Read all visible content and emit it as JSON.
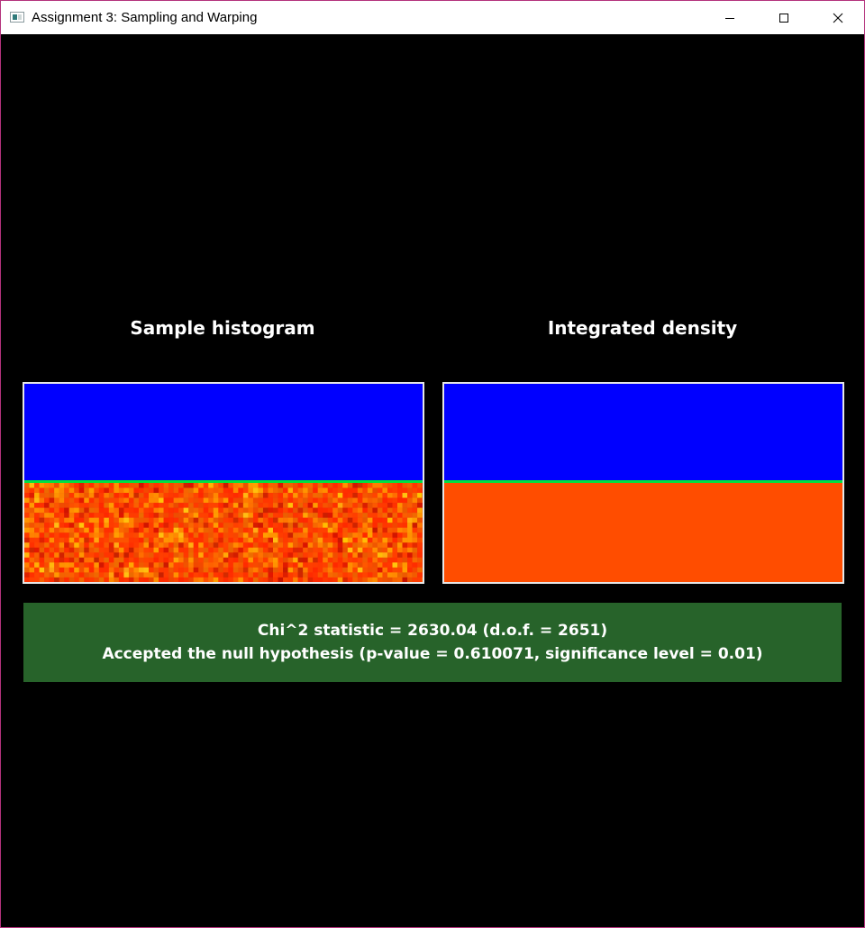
{
  "window": {
    "title": "Assignment 3: Sampling and Warping",
    "controls": {
      "minimize": "minimize",
      "maximize": "maximize",
      "close": "close"
    }
  },
  "panels": {
    "left_title": "Sample histogram",
    "right_title": "Integrated density"
  },
  "colors": {
    "background": "#000000",
    "panel_border": "#e6e6e6",
    "upper_region": "#0000ff",
    "boundary_line": "#00e040",
    "density_lower_region": "#ff4d00",
    "result_background": "#27632a"
  },
  "result": {
    "statistic_line": "Chi^2 statistic = 2630.04 (d.o.f. = 2651)",
    "hypothesis_line": "Accepted the null hypothesis (p-value = 0.610071, significance level = 0.01)"
  }
}
